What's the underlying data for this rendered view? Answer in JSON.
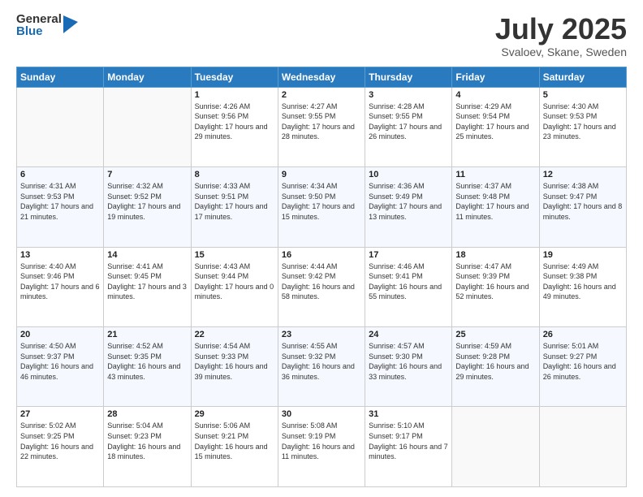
{
  "header": {
    "logo_general": "General",
    "logo_blue": "Blue",
    "month_year": "July 2025",
    "location": "Svaloev, Skane, Sweden"
  },
  "days_of_week": [
    "Sunday",
    "Monday",
    "Tuesday",
    "Wednesday",
    "Thursday",
    "Friday",
    "Saturday"
  ],
  "weeks": [
    [
      {
        "day": null
      },
      {
        "day": null
      },
      {
        "day": 1,
        "sunrise": "4:26 AM",
        "sunset": "9:56 PM",
        "daylight": "17 hours and 29 minutes."
      },
      {
        "day": 2,
        "sunrise": "4:27 AM",
        "sunset": "9:55 PM",
        "daylight": "17 hours and 28 minutes."
      },
      {
        "day": 3,
        "sunrise": "4:28 AM",
        "sunset": "9:55 PM",
        "daylight": "17 hours and 26 minutes."
      },
      {
        "day": 4,
        "sunrise": "4:29 AM",
        "sunset": "9:54 PM",
        "daylight": "17 hours and 25 minutes."
      },
      {
        "day": 5,
        "sunrise": "4:30 AM",
        "sunset": "9:53 PM",
        "daylight": "17 hours and 23 minutes."
      }
    ],
    [
      {
        "day": 6,
        "sunrise": "4:31 AM",
        "sunset": "9:53 PM",
        "daylight": "17 hours and 21 minutes."
      },
      {
        "day": 7,
        "sunrise": "4:32 AM",
        "sunset": "9:52 PM",
        "daylight": "17 hours and 19 minutes."
      },
      {
        "day": 8,
        "sunrise": "4:33 AM",
        "sunset": "9:51 PM",
        "daylight": "17 hours and 17 minutes."
      },
      {
        "day": 9,
        "sunrise": "4:34 AM",
        "sunset": "9:50 PM",
        "daylight": "17 hours and 15 minutes."
      },
      {
        "day": 10,
        "sunrise": "4:36 AM",
        "sunset": "9:49 PM",
        "daylight": "17 hours and 13 minutes."
      },
      {
        "day": 11,
        "sunrise": "4:37 AM",
        "sunset": "9:48 PM",
        "daylight": "17 hours and 11 minutes."
      },
      {
        "day": 12,
        "sunrise": "4:38 AM",
        "sunset": "9:47 PM",
        "daylight": "17 hours and 8 minutes."
      }
    ],
    [
      {
        "day": 13,
        "sunrise": "4:40 AM",
        "sunset": "9:46 PM",
        "daylight": "17 hours and 6 minutes."
      },
      {
        "day": 14,
        "sunrise": "4:41 AM",
        "sunset": "9:45 PM",
        "daylight": "17 hours and 3 minutes."
      },
      {
        "day": 15,
        "sunrise": "4:43 AM",
        "sunset": "9:44 PM",
        "daylight": "17 hours and 0 minutes."
      },
      {
        "day": 16,
        "sunrise": "4:44 AM",
        "sunset": "9:42 PM",
        "daylight": "16 hours and 58 minutes."
      },
      {
        "day": 17,
        "sunrise": "4:46 AM",
        "sunset": "9:41 PM",
        "daylight": "16 hours and 55 minutes."
      },
      {
        "day": 18,
        "sunrise": "4:47 AM",
        "sunset": "9:39 PM",
        "daylight": "16 hours and 52 minutes."
      },
      {
        "day": 19,
        "sunrise": "4:49 AM",
        "sunset": "9:38 PM",
        "daylight": "16 hours and 49 minutes."
      }
    ],
    [
      {
        "day": 20,
        "sunrise": "4:50 AM",
        "sunset": "9:37 PM",
        "daylight": "16 hours and 46 minutes."
      },
      {
        "day": 21,
        "sunrise": "4:52 AM",
        "sunset": "9:35 PM",
        "daylight": "16 hours and 43 minutes."
      },
      {
        "day": 22,
        "sunrise": "4:54 AM",
        "sunset": "9:33 PM",
        "daylight": "16 hours and 39 minutes."
      },
      {
        "day": 23,
        "sunrise": "4:55 AM",
        "sunset": "9:32 PM",
        "daylight": "16 hours and 36 minutes."
      },
      {
        "day": 24,
        "sunrise": "4:57 AM",
        "sunset": "9:30 PM",
        "daylight": "16 hours and 33 minutes."
      },
      {
        "day": 25,
        "sunrise": "4:59 AM",
        "sunset": "9:28 PM",
        "daylight": "16 hours and 29 minutes."
      },
      {
        "day": 26,
        "sunrise": "5:01 AM",
        "sunset": "9:27 PM",
        "daylight": "16 hours and 26 minutes."
      }
    ],
    [
      {
        "day": 27,
        "sunrise": "5:02 AM",
        "sunset": "9:25 PM",
        "daylight": "16 hours and 22 minutes."
      },
      {
        "day": 28,
        "sunrise": "5:04 AM",
        "sunset": "9:23 PM",
        "daylight": "16 hours and 18 minutes."
      },
      {
        "day": 29,
        "sunrise": "5:06 AM",
        "sunset": "9:21 PM",
        "daylight": "16 hours and 15 minutes."
      },
      {
        "day": 30,
        "sunrise": "5:08 AM",
        "sunset": "9:19 PM",
        "daylight": "16 hours and 11 minutes."
      },
      {
        "day": 31,
        "sunrise": "5:10 AM",
        "sunset": "9:17 PM",
        "daylight": "16 hours and 7 minutes."
      },
      {
        "day": null
      },
      {
        "day": null
      }
    ]
  ]
}
